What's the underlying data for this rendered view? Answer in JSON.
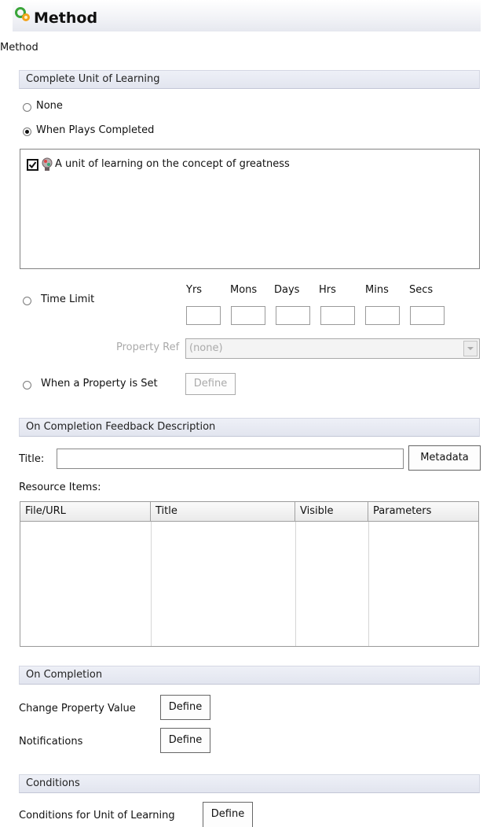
{
  "header": {
    "title": "Method",
    "subtitle": "Method"
  },
  "complete_unit": {
    "section_label": "Complete Unit of Learning",
    "option_none": "None",
    "option_plays": "When Plays Completed",
    "play_item": "A unit of learning on the concept of greatness",
    "option_time_limit": "Time Limit",
    "time_columns": [
      "Yrs",
      "Mons",
      "Days",
      "Hrs",
      "Mins",
      "Secs"
    ],
    "property_ref_label": "Property Ref",
    "property_ref_value": "(none)",
    "option_property_set": "When a Property is Set",
    "define_label": "Define"
  },
  "feedback": {
    "section_label": "On Completion Feedback Description",
    "title_label": "Title:",
    "title_value": "",
    "metadata_label": "Metadata",
    "resource_items_label": "Resource Items:",
    "columns": [
      "File/URL",
      "Title",
      "Visible",
      "Parameters"
    ]
  },
  "on_completion": {
    "section_label": "On Completion",
    "change_property_label": "Change Property Value",
    "notifications_label": "Notifications",
    "define_label": "Define"
  },
  "conditions": {
    "section_label": "Conditions",
    "unit_conditions_label": "Conditions for Unit of Learning",
    "define_label": "Define"
  },
  "state": {
    "selected_completion_option": "When Plays Completed",
    "play_item_checked": true
  },
  "colors": {
    "section_header_bg": "#e6e8f1",
    "icon_green": "#3aa53a",
    "icon_orange": "#f2a21a"
  }
}
